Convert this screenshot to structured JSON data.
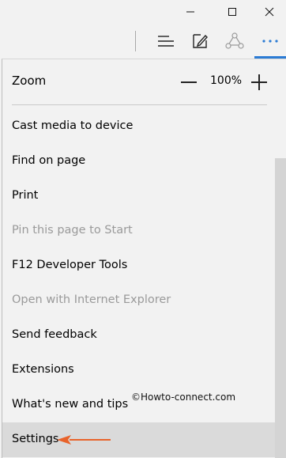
{
  "window": {
    "controls": [
      {
        "name": "minimize-icon"
      },
      {
        "name": "maximize-icon"
      },
      {
        "name": "close-icon"
      }
    ]
  },
  "toolbar": {
    "icons": [
      "hub-icon",
      "web-note-icon",
      "share-icon",
      "more-actions-icon"
    ]
  },
  "menu": {
    "zoom": {
      "label": "Zoom",
      "value": "100%"
    },
    "items": [
      {
        "label": "Cast media to device",
        "enabled": true
      },
      {
        "label": "Find on page",
        "enabled": true
      },
      {
        "label": "Print",
        "enabled": true
      },
      {
        "label": "Pin this page to Start",
        "enabled": false
      },
      {
        "label": "F12 Developer Tools",
        "enabled": true
      },
      {
        "label": "Open with Internet Explorer",
        "enabled": false
      },
      {
        "label": "Send feedback",
        "enabled": true
      },
      {
        "label": "Extensions",
        "enabled": true
      },
      {
        "label": "What's new and tips",
        "enabled": true
      },
      {
        "label": "Settings",
        "enabled": true,
        "selected": true
      }
    ]
  },
  "watermark": "©Howto-connect.com",
  "colors": {
    "accent": "#2b7bd4",
    "arrow": "#e8632b"
  }
}
